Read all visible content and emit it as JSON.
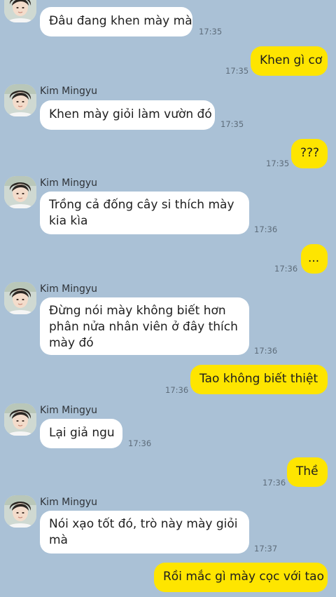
{
  "messages": [
    {
      "side": "in",
      "sender": "",
      "text": "Đâu đang khen mày mà",
      "time": "17:35"
    },
    {
      "side": "out",
      "text": "Khen gì cơ",
      "time": "17:35"
    },
    {
      "side": "in",
      "sender": "Kim Mingyu",
      "text": "Khen mày giỏi làm vườn đó",
      "time": "17:35"
    },
    {
      "side": "out",
      "text": "???",
      "time": "17:35"
    },
    {
      "side": "in",
      "sender": "Kim Mingyu",
      "lines": [
        "Trồng cả đống cây si thích mày",
        "kia kìa"
      ],
      "time": "17:36"
    },
    {
      "side": "out",
      "text": "...",
      "time": "17:36"
    },
    {
      "side": "in",
      "sender": "Kim Mingyu",
      "lines": [
        "Đừng nói mày không biết hơn",
        "phân nửa nhân viên ở đây thích",
        "mày đó"
      ],
      "time": "17:36"
    },
    {
      "side": "out",
      "text": "Tao không biết thiệt",
      "time": "17:36"
    },
    {
      "side": "in",
      "sender": "Kim Mingyu",
      "text": "Lại giả ngu",
      "time": "17:36"
    },
    {
      "side": "out",
      "text": "Thề",
      "time": "17:36"
    },
    {
      "side": "in",
      "sender": "Kim Mingyu",
      "lines": [
        "Nói xạo tốt đó, trò này mày giỏi",
        "mà"
      ],
      "time": "17:37"
    },
    {
      "side": "out",
      "text": "Rồi mắc gì mày cọc với tao",
      "time": ""
    }
  ]
}
